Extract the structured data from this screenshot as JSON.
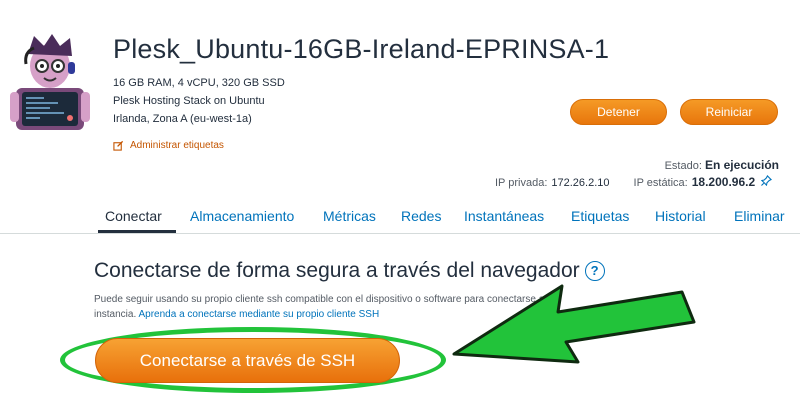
{
  "instance": {
    "name": "Plesk_Ubuntu-16GB-Ireland-EPRINSA-1",
    "specs": "16 GB RAM, 4 vCPU, 320 GB SSD",
    "stack": "Plesk Hosting Stack on Ubuntu",
    "location": "Irlanda, Zona A (eu-west-1a)",
    "manage_tags": "Administrar etiquetas"
  },
  "actions": {
    "stop": "Detener",
    "restart": "Reiniciar"
  },
  "status": {
    "label": "Estado:",
    "value": "En ejecución",
    "private_ip_label": "IP privada:",
    "private_ip": "172.26.2.10",
    "static_ip_label": "IP estática:",
    "static_ip": "18.200.96.2"
  },
  "tabs": [
    {
      "label": "Conectar",
      "active": true
    },
    {
      "label": "Almacenamiento"
    },
    {
      "label": "Métricas"
    },
    {
      "label": "Redes"
    },
    {
      "label": "Instantáneas"
    },
    {
      "label": "Etiquetas"
    },
    {
      "label": "Historial"
    },
    {
      "label": "Eliminar"
    }
  ],
  "connect": {
    "title": "Conectarse de forma segura a través del navegador",
    "help": "?",
    "description": "Puede seguir usando su propio cliente ssh compatible con el dispositivo o software para conectarse a la instancia. ",
    "link": "Aprenda a conectarse mediante su propio cliente SSH",
    "ssh_button": "Conectarse a través de SSH"
  },
  "colors": {
    "accent": "#ec7211",
    "link": "#0073bb",
    "highlight": "#22c33a",
    "text": "#232f3e"
  },
  "icons": {
    "avatar": "instance-avatar",
    "tag": "edit-icon",
    "pin": "pin-icon",
    "help": "help-icon",
    "arrow": "annotation-arrow"
  }
}
